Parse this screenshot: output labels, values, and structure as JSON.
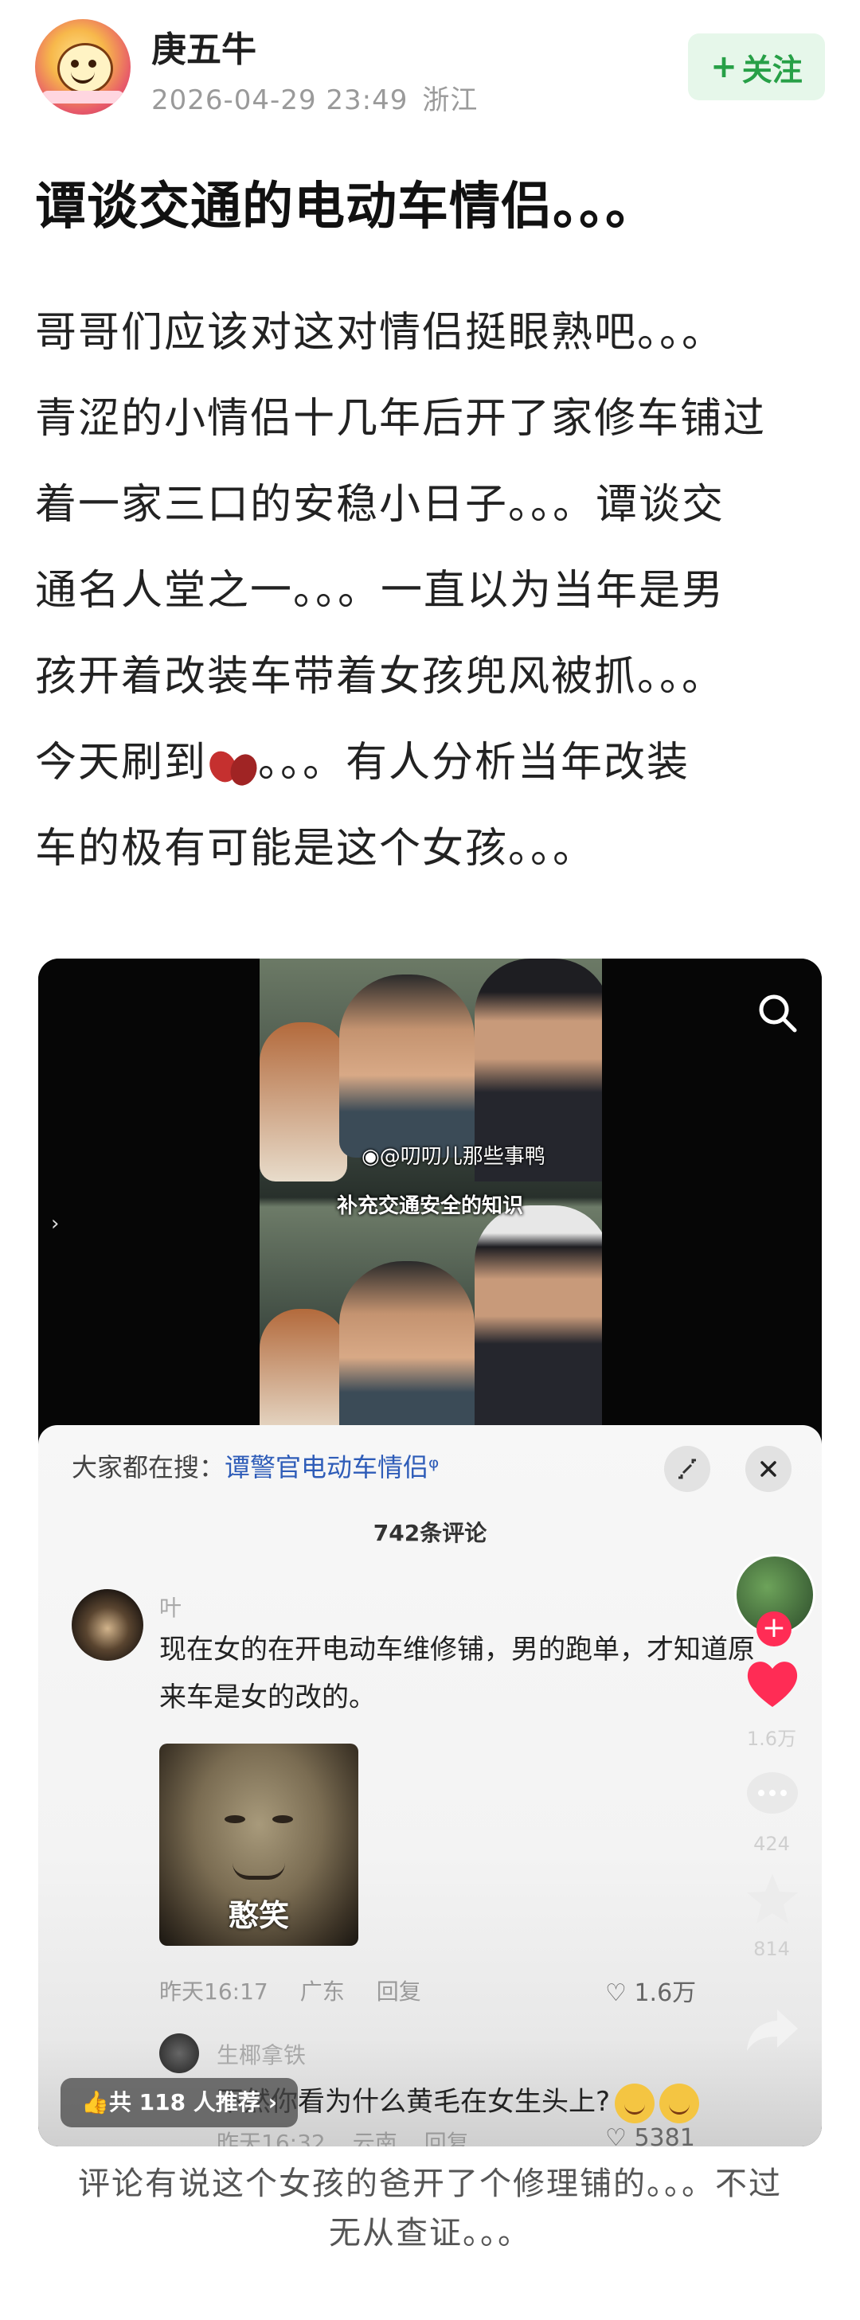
{
  "post": {
    "author": "庚五牛",
    "timestamp": "2026-04-29 23:49",
    "location": "浙江",
    "follow_label": "关注",
    "follow_plus": "+",
    "title": "谭谈交通的电动车情侣。。。",
    "body_lines": [
      "哥哥们应该对这对情侣挺眼熟吧。。。",
      "青涩的小情侣十几年后开了家修车铺过",
      "着一家三口的安稳小日子。。。谭谈交",
      "通名人堂之一。。。一直以为当年是男",
      "孩开着改装车带着女孩兜风被抓。。。",
      "今天刷到",
      "。。。有人分析当年改装",
      "车的极有可能是这个女孩。。。"
    ],
    "caption_lines": [
      "评论有说这个女孩的爸开了个修理铺的。。。不过",
      "无从查证。。。"
    ]
  },
  "embed": {
    "watermark": "@叨叨儿那些事鸭",
    "subtitle": "补充交通安全的知识",
    "search_prefix": "大家都在搜：",
    "search_keyword": "谭警官电动车情侣",
    "comment_count": "742条评论",
    "comment": {
      "user": "叶",
      "text": "现在女的在开电动车维修铺，男的跑单，才知道原来车是女的改的。",
      "meme_caption": "憨笑",
      "time": "昨天16:17",
      "region": "广东",
      "reply_label": "回复",
      "likes": "1.6万"
    },
    "reply": {
      "user": "生椰拿铁",
      "text": "不然你看为什么黄毛在女生头上?",
      "time": "昨天16:32",
      "region": "云南",
      "reply_label": "回复",
      "likes": "5381"
    },
    "side": {
      "like_count": "1.6万",
      "comment_count": "424",
      "fav_count": "814"
    },
    "recommend": "共 118 人推荐 ›"
  },
  "colors": {
    "follow_green": "#27a047",
    "follow_bg": "#e6f7ea",
    "keyword_blue": "#2e5cb8",
    "like_red": "#ff2c55"
  },
  "icons": [
    "search-icon",
    "expand-icon",
    "close-icon",
    "heart-icon",
    "comment-icon",
    "star-icon",
    "share-icon",
    "like-outline-icon",
    "thumb-up-icon",
    "bean-emoji",
    "weibo-icon"
  ]
}
